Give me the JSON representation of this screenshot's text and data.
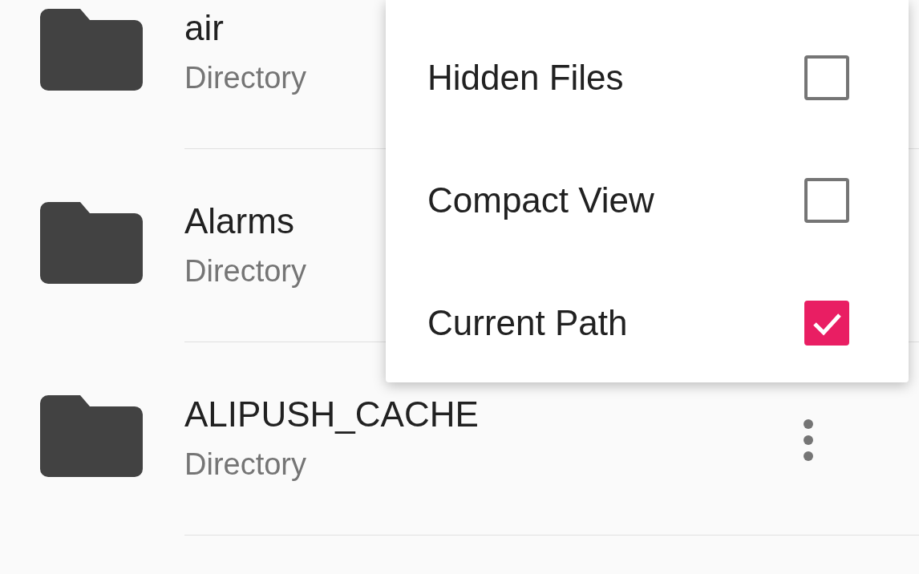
{
  "files": [
    {
      "name": "air",
      "subtitle": "Directory",
      "more_button": false
    },
    {
      "name": "Alarms",
      "subtitle": "Directory",
      "more_button": false
    },
    {
      "name": "ALIPUSH_CACHE",
      "subtitle": "Directory",
      "more_button": true
    }
  ],
  "menu": {
    "items": [
      {
        "label": "Hidden Files",
        "checked": false
      },
      {
        "label": "Compact View",
        "checked": false
      },
      {
        "label": "Current Path",
        "checked": true
      }
    ]
  }
}
